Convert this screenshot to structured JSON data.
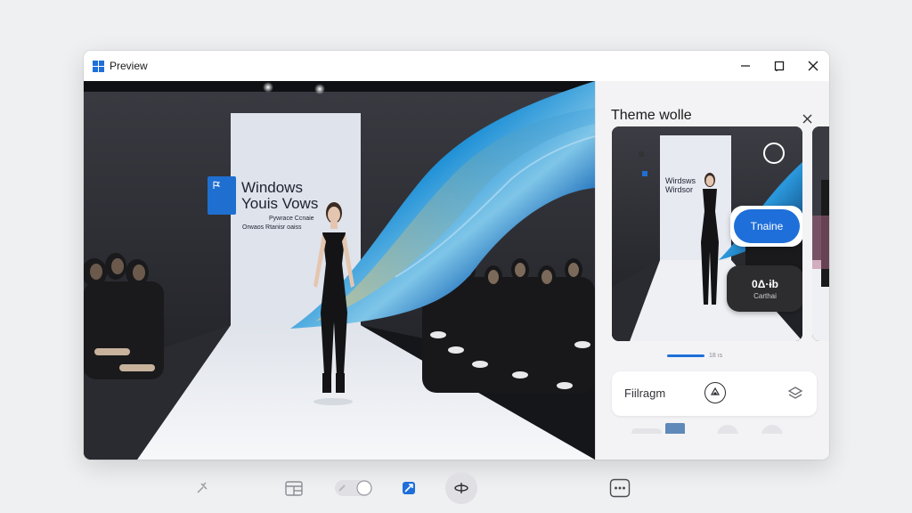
{
  "window": {
    "title": "Preview",
    "controls": [
      "minimize",
      "maximize",
      "close"
    ]
  },
  "photo": {
    "backdrop_line1": "Windows",
    "backdrop_line2": "Youis Vows",
    "backdrop_line3": "Pywrace Ccnaie",
    "backdrop_line4": "Orwaos Rtanisr oaiss"
  },
  "panel": {
    "title": "Theme wolle",
    "thumbnail": {
      "backdrop_line1": "Wirdsws",
      "backdrop_line2": "Wirdsor",
      "primary_pill": "Tnaine",
      "secondary_pill_value": "0Δ·ɨb",
      "secondary_pill_label": "Carthai"
    },
    "pager_count": "18 ıs",
    "filter_label": "Fiilragm"
  },
  "colors": {
    "accent": "#1e6fd9",
    "window_bg": "#ffffff",
    "panel_bg": "#f3f3f5",
    "desktop_bg": "#eff0f2"
  },
  "taskbar": {
    "icons": [
      "pin-icon",
      "widgets-icon",
      "toggle-icon",
      "edit-app-icon",
      "share-icon",
      "more-icon"
    ]
  }
}
